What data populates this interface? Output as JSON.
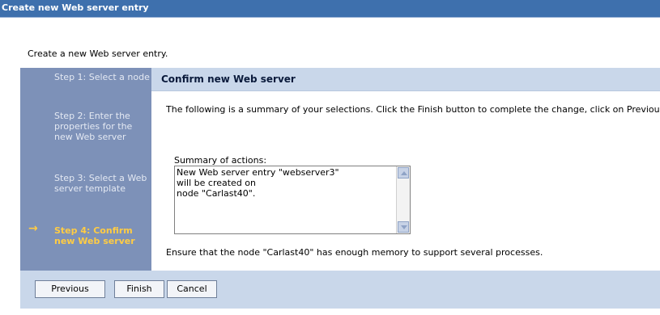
{
  "window": {
    "title": "Create new Web server entry"
  },
  "intro_text": "Create a new Web server entry.",
  "wizard": {
    "steps": [
      {
        "label": "Step 1: Select a node",
        "current": false
      },
      {
        "label": "Step 2: Enter the properties for the new Web server",
        "current": false
      },
      {
        "label": "Step 3: Select a Web server template",
        "current": false
      },
      {
        "label": "Step 4: Confirm new Web server",
        "current": true
      }
    ],
    "current_arrow": "→"
  },
  "content": {
    "heading": "Confirm new Web server",
    "summary_text": "The following is a summary of your selections. Click the Finish button to complete the change, click on Previous button to review the server settings.",
    "summary_label": "Summary of actions:",
    "summary_value": "New Web server entry \"webserver3\"\nwill be created on\nnode \"Carlast40\".",
    "warning": "Ensure that the node \"Carlast40\" has enough memory to support several processes."
  },
  "buttons": {
    "previous": "Previous",
    "finish": "Finish",
    "cancel": "Cancel"
  },
  "colors": {
    "title_bar": "#3e70ad",
    "steps_panel": "#7d91b8",
    "current_step": "#ffcc44",
    "header": "#c9d7ea"
  }
}
